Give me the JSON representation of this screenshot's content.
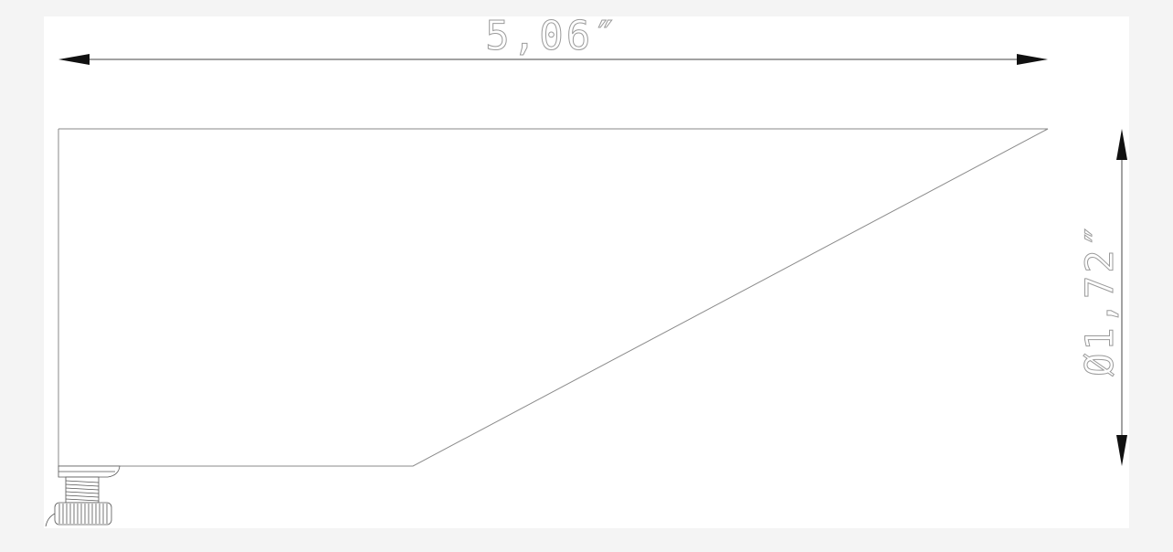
{
  "drawing": {
    "dimensions": {
      "width_label": "5,06″",
      "diameter_label": "Ø1,72″"
    },
    "colors": {
      "background": "#f4f4f4",
      "sheet": "#ffffff",
      "line": "#6e6e6e",
      "dimension_text": "#9a9a9a",
      "arrow": "#111111"
    }
  }
}
